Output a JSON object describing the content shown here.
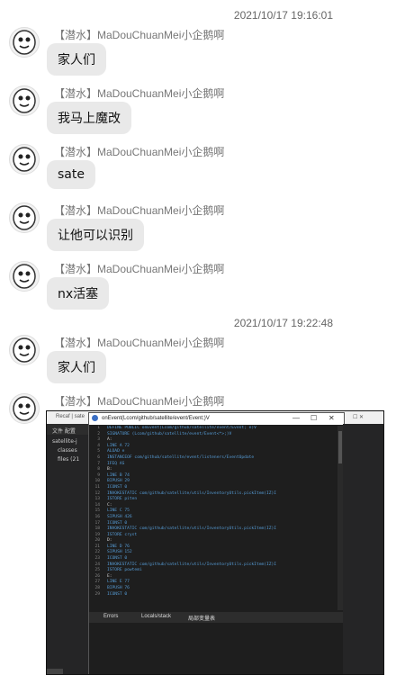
{
  "timestamps": [
    "2021/10/17 19:16:01",
    "2021/10/17 19:22:48"
  ],
  "messages": [
    {
      "sender": "【潜水】MaDouChuanMei小企鹅啊",
      "text": "家人们"
    },
    {
      "sender": "【潜水】MaDouChuanMei小企鹅啊",
      "text": "我马上魔改"
    },
    {
      "sender": "【潜水】MaDouChuanMei小企鹅啊",
      "text": "sate"
    },
    {
      "sender": "【潜水】MaDouChuanMei小企鹅啊",
      "text": "让他可以识别"
    },
    {
      "sender": "【潜水】MaDouChuanMei小企鹅啊",
      "text": "nx活塞"
    },
    {
      "sender": "【潜水】MaDouChuanMei小企鹅啊",
      "text": "家人们"
    },
    {
      "sender": "【潜水】MaDouChuanMei小企鹅啊",
      "text": ""
    }
  ],
  "screenshot": {
    "bg_title": "Recaf | sate",
    "bg_menu": "文件   配置",
    "bg_tree": [
      "satellite-j",
      "classes",
      "files (21"
    ],
    "window_title": "onEvent(Lcom/github/satellite/event/Event;)V",
    "window_controls": [
      "—",
      "☐",
      "✕"
    ],
    "code_lines": [
      {
        "n": "1",
        "text": "DEFINE PUBLIC onEvent(Lcom/github/satellite/event/Event; e)V"
      },
      {
        "n": "2",
        "text": "SIGNATURE (Lcom/github/satellite/event/Event<*>;)V"
      },
      {
        "n": "3",
        "text": "A:"
      },
      {
        "n": "4",
        "text": "LINE A 72"
      },
      {
        "n": "5",
        "text": "ALOAD e"
      },
      {
        "n": "6",
        "text": "INSTANCEOF com/github/satellite/event/listeners/EventUpdate"
      },
      {
        "n": "7",
        "text": "IFEQ AS"
      },
      {
        "n": "8",
        "text": "B:"
      },
      {
        "n": "9",
        "text": "LINE B 74"
      },
      {
        "n": "10",
        "text": "BIPUSH 29"
      },
      {
        "n": "11",
        "text": "ICONST 0"
      },
      {
        "n": "12",
        "text": "INVOKESTATIC com/github/satellite/utils/InventoryUtils.pickItem(IZ)I"
      },
      {
        "n": "13",
        "text": "ISTORE piten"
      },
      {
        "n": "14",
        "text": "C:"
      },
      {
        "n": "15",
        "text": "LINE C 75"
      },
      {
        "n": "16",
        "text": "SIPUSH 426"
      },
      {
        "n": "17",
        "text": "ICONST 0"
      },
      {
        "n": "18",
        "text": "INVOKESTATIC com/github/satellite/utils/InventoryUtils.pickItem(IZ)I"
      },
      {
        "n": "19",
        "text": "ISTORE cryst"
      },
      {
        "n": "20",
        "text": "D:"
      },
      {
        "n": "21",
        "text": "LINE D 76"
      },
      {
        "n": "22",
        "text": "SIPUSH 152"
      },
      {
        "n": "23",
        "text": "ICONST 0"
      },
      {
        "n": "24",
        "text": "INVOKESTATIC com/github/satellite/utils/InventoryUtils.pickItem(IZ)I"
      },
      {
        "n": "25",
        "text": "ISTORE powtemi"
      },
      {
        "n": "26",
        "text": "E:"
      },
      {
        "n": "27",
        "text": "LINE E 77"
      },
      {
        "n": "28",
        "text": "BIPUSH 76"
      },
      {
        "n": "29",
        "text": "ICONST 0"
      }
    ],
    "tabs": [
      "Errors",
      "Locals/stack",
      "局部变量表"
    ]
  }
}
